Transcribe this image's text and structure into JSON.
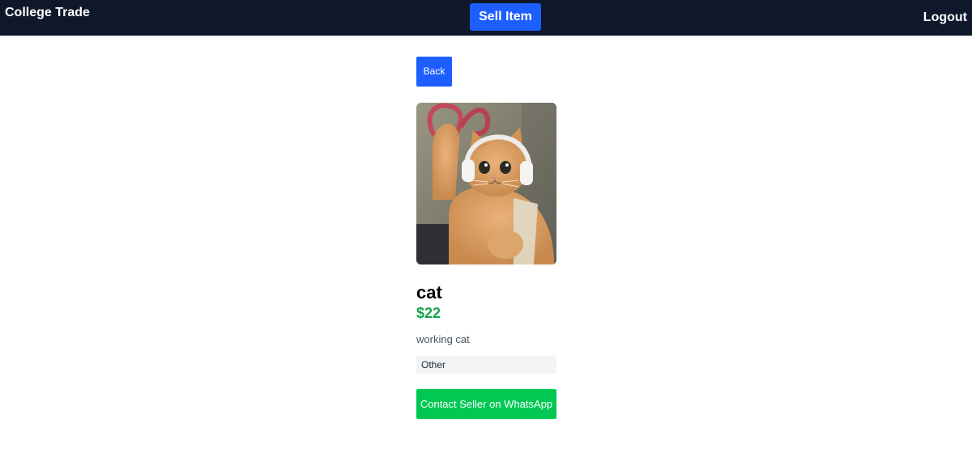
{
  "header": {
    "brand": "College Trade",
    "sell_label": "Sell Item",
    "logout_label": "Logout"
  },
  "product": {
    "back_label": "Back",
    "image_alt": "cat",
    "title": "cat",
    "price": "$22",
    "description": "working cat",
    "category": "Other",
    "contact_label": "Contact Seller on WhatsApp"
  },
  "colors": {
    "navbar_bg": "#0f172a",
    "primary_button": "#1d5eff",
    "price_green": "#16a34a",
    "whatsapp_green": "#00c853",
    "category_bg": "#f3f4f6"
  }
}
